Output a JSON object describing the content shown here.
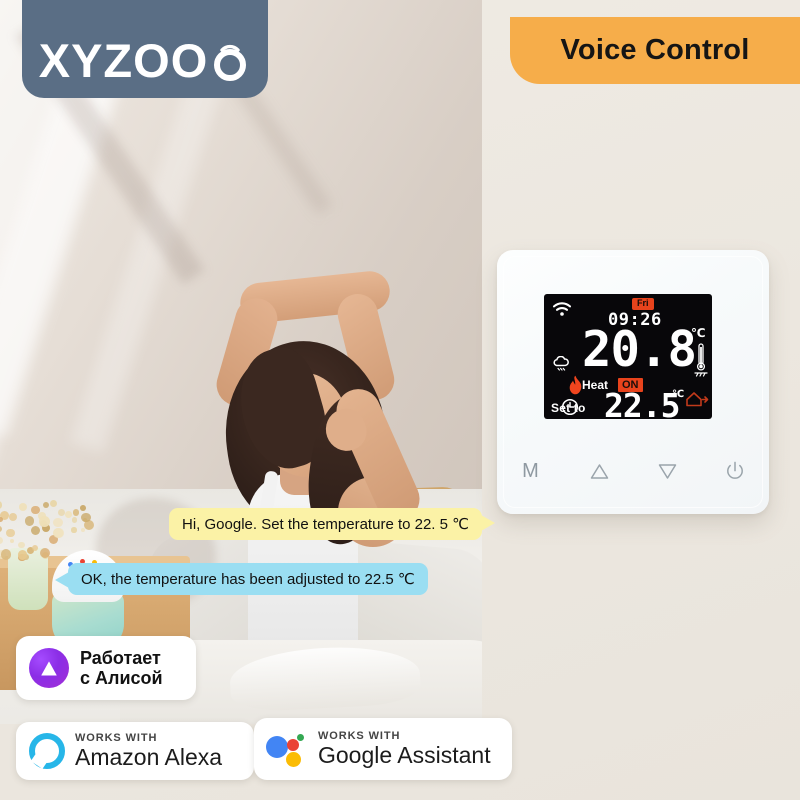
{
  "brand": {
    "logo_text": "XYZOO",
    "logo_icon": "ring-logo-mark"
  },
  "banner": {
    "title": "Voice Control",
    "color": "#f6ad4a"
  },
  "thermostat": {
    "display": {
      "day": "Fri",
      "time": "09:26",
      "current_temp": "20.8",
      "current_unit": "℃",
      "mode_label": "Heat",
      "mode_state": "ON",
      "set_label": "Set to",
      "set_temp": "22.5",
      "set_unit": "℃",
      "icons": {
        "wifi": "wifi-icon",
        "frost": "anti-frost-cloud-icon",
        "flame": "flame-icon",
        "clock": "clock-icon",
        "thermometer": "floor-thermometer-icon",
        "house": "away-house-icon"
      },
      "accent_color": "#e8431c"
    },
    "buttons": [
      {
        "name": "mode",
        "glyph": "M"
      },
      {
        "name": "up",
        "glyph": "△"
      },
      {
        "name": "down",
        "glyph": "▽"
      },
      {
        "name": "power",
        "glyph": "⏻"
      }
    ]
  },
  "conversation": [
    {
      "speaker": "user",
      "text": "Hi, Google. Set the temperature to 22. 5 ℃",
      "color": "#fbf2a6"
    },
    {
      "speaker": "assistant",
      "text": "OK, the temperature has been adjusted to 22.5 ℃",
      "color": "#9adef2"
    }
  ],
  "partners": {
    "alice": {
      "line1": "Работает",
      "line2": "с Алисой",
      "icon": "yandex-alice-icon"
    },
    "alexa": {
      "works_with": "WORKS WITH",
      "brand": "Amazon Alexa",
      "icon": "amazon-alexa-icon",
      "color": "#27b6e8"
    },
    "google": {
      "works_with": "WORKS WITH",
      "brand": "Google Assistant",
      "icon": "google-assistant-icon",
      "dot_colors": [
        "#4285f4",
        "#ea4335",
        "#34a853",
        "#fbbc05"
      ]
    }
  }
}
